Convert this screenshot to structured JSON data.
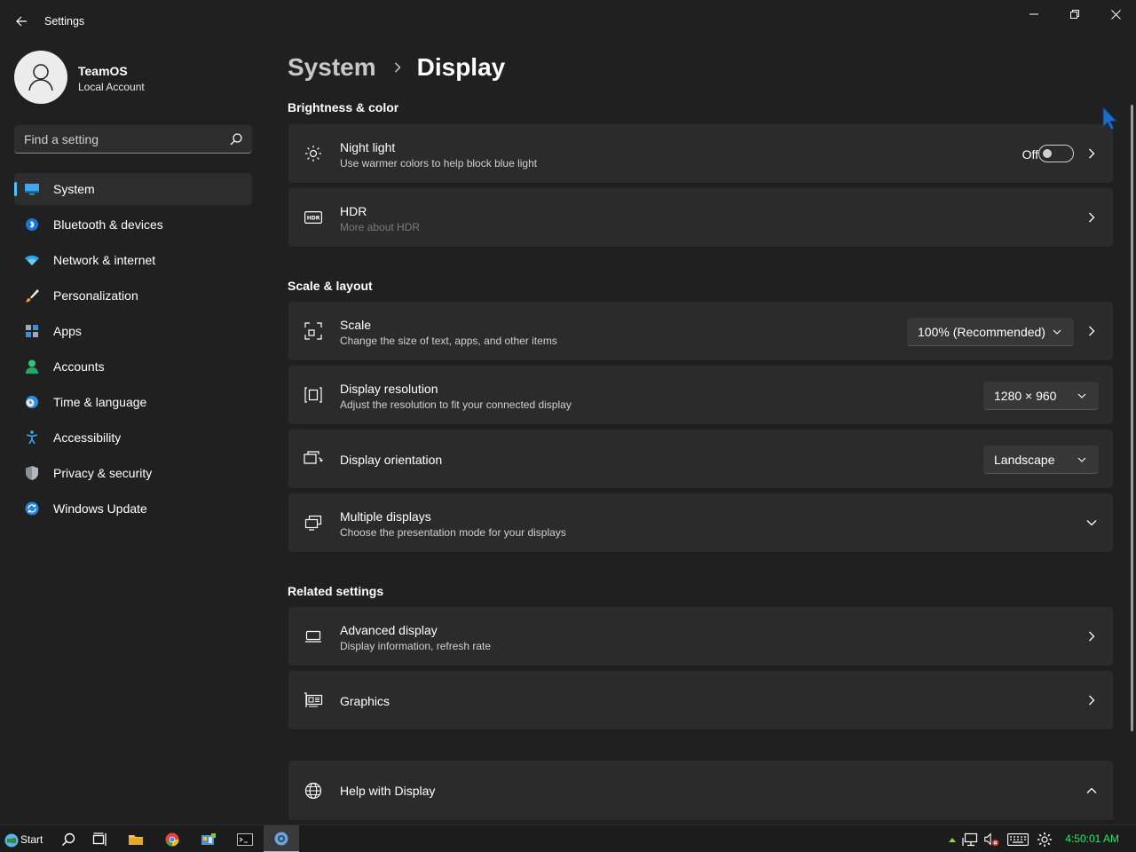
{
  "window": {
    "title": "Settings",
    "controls": {
      "minimize": "minimize-icon",
      "maximize": "restore-icon",
      "close": "close-icon"
    }
  },
  "profile": {
    "name": "TeamOS",
    "account_type": "Local Account"
  },
  "search": {
    "placeholder": "Find a setting"
  },
  "nav": {
    "items": [
      {
        "label": "System",
        "icon": "system-icon",
        "selected": true
      },
      {
        "label": "Bluetooth & devices",
        "icon": "bluetooth-icon"
      },
      {
        "label": "Network & internet",
        "icon": "wifi-icon"
      },
      {
        "label": "Personalization",
        "icon": "brush-icon"
      },
      {
        "label": "Apps",
        "icon": "apps-icon"
      },
      {
        "label": "Accounts",
        "icon": "accounts-icon"
      },
      {
        "label": "Time & language",
        "icon": "clock-globe-icon"
      },
      {
        "label": "Accessibility",
        "icon": "accessibility-icon"
      },
      {
        "label": "Privacy & security",
        "icon": "shield-icon"
      },
      {
        "label": "Windows Update",
        "icon": "update-icon"
      }
    ]
  },
  "breadcrumb": {
    "parent": "System",
    "current": "Display"
  },
  "sections": {
    "brightness": {
      "title": "Brightness & color",
      "night_light": {
        "title": "Night light",
        "subtitle": "Use warmer colors to help block blue light",
        "toggle_state": "Off"
      },
      "hdr": {
        "title": "HDR",
        "subtitle": "More about HDR"
      }
    },
    "scale_layout": {
      "title": "Scale & layout",
      "scale": {
        "title": "Scale",
        "subtitle": "Change the size of text, apps, and other items",
        "value": "100% (Recommended)"
      },
      "resolution": {
        "title": "Display resolution",
        "subtitle": "Adjust the resolution to fit your connected display",
        "value": "1280 × 960"
      },
      "orientation": {
        "title": "Display orientation",
        "value": "Landscape"
      },
      "multiple": {
        "title": "Multiple displays",
        "subtitle": "Choose the presentation mode for your displays"
      }
    },
    "related": {
      "title": "Related settings",
      "advanced": {
        "title": "Advanced display",
        "subtitle": "Display information, refresh rate"
      },
      "graphics": {
        "title": "Graphics"
      }
    },
    "help": {
      "title": "Help with Display"
    }
  },
  "taskbar": {
    "start_label": "Start",
    "clock": "4:50:01 AM"
  },
  "colors": {
    "accent": "#4cc2ff",
    "background": "#202020",
    "card": "#2b2b2b",
    "clock": "#33e06d"
  }
}
